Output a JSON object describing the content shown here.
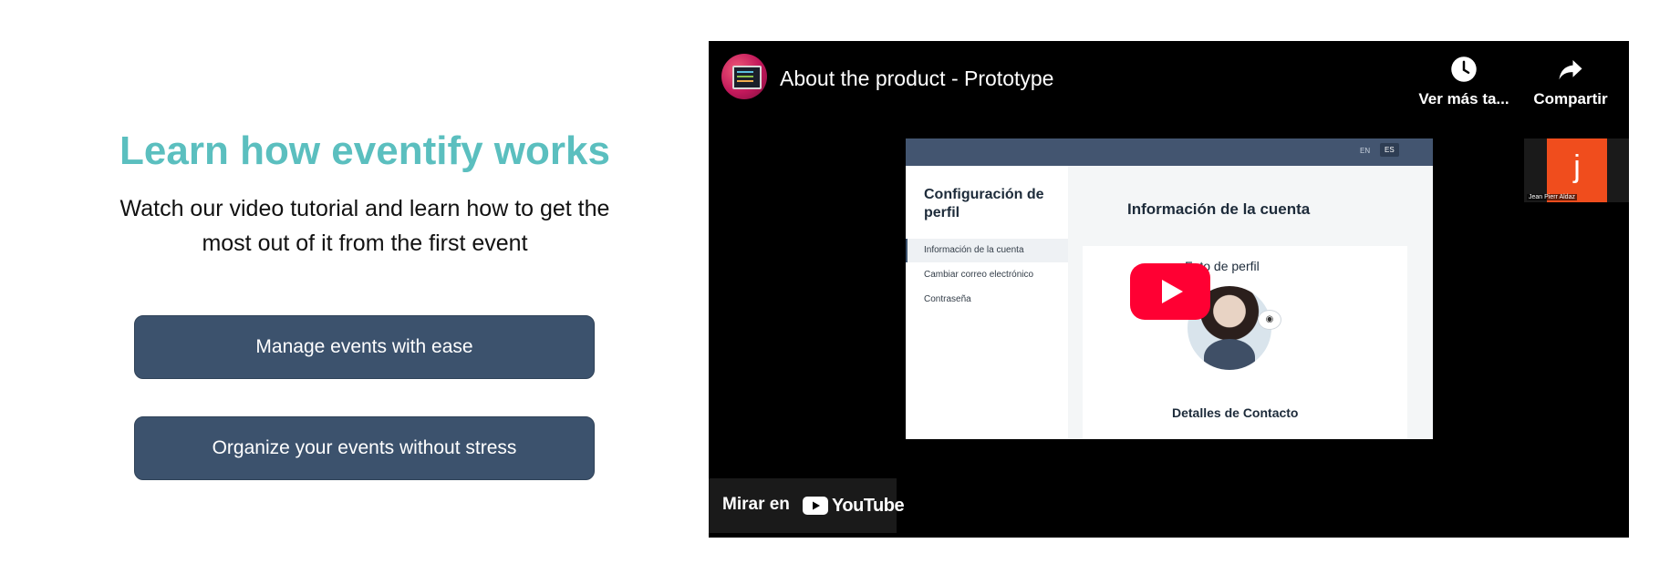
{
  "intro": {
    "headline": "Learn how eventify works",
    "subtext_line1": "Watch our video tutorial and learn how to get the",
    "subtext_line2": "most out of it from the first event"
  },
  "buttons": {
    "manage_label": "Manage events with ease",
    "organize_label": "Organize your events without stress"
  },
  "colors": {
    "headline": "#5bbfbf",
    "button_bg": "#3c526d",
    "player_bg": "#000000",
    "play_button": "#ff0033"
  },
  "video": {
    "title": "About the product - Prototype",
    "watch_later_label": "Ver más ta...",
    "share_label": "Compartir",
    "watch_on_label": "Mirar en",
    "youtube_wordmark": "YouTube",
    "icons": {
      "channel": "channel-avatar",
      "watch_later": "clock-icon",
      "share": "share-arrow-icon",
      "play": "play-icon",
      "youtube": "youtube-logo-icon"
    },
    "frame": {
      "lang_en": "EN",
      "lang_es": "ES",
      "sidebar_title": "Configuración de perfil",
      "sidebar_items": [
        "Información de la cuenta",
        "Cambiar correo electrónico",
        "Contraseña"
      ],
      "main_title": "Información de la cuenta",
      "photo_label": "Foto de perfil",
      "contact_label": "Detalles de Contacto"
    },
    "webcam": {
      "initial": "j",
      "name": "Jean Pierr Aldaz"
    }
  }
}
